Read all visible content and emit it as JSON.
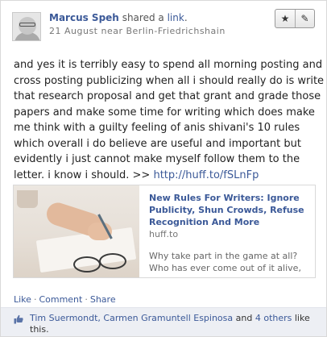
{
  "post": {
    "author": "Marcus Speh",
    "shared_text": "shared a",
    "shared_object": "link",
    "shared_dot": ".",
    "date_location": "21 August near Berlin-Friedrichshain",
    "actions_icons": [
      "star-icon",
      "pencil-icon"
    ],
    "text_lines": [
      "and yes it is terribly easy to spend all morning posting and",
      "cross posting publicizing when all i should really do is write",
      "that research proposal and get that grant and grade those",
      "papers and make some time for writing which does make",
      "me think with a guilty feeling of anis shivani's 10 rules",
      "which overall i do believe are useful and important but",
      "evidently i just cannot make myself follow them to the",
      "letter. i know i should. >> "
    ],
    "text_link": "http://huff.to/fSLnFp"
  },
  "preview": {
    "title_lines": [
      "New Rules For Writers: Ignore",
      "Publicity, Shun Crowds, Refuse",
      "Recognition And More"
    ],
    "domain": "huff.to",
    "description_lines": [
      "Why take part in the game at all?",
      "Who has ever come out of it alive,"
    ]
  },
  "footer": {
    "like": "Like",
    "comment": "Comment",
    "share": "Share",
    "sep": "·",
    "likers": "Tim Suermondt, Carmen Gramuntell Espinosa",
    "and_text": " and ",
    "others": "4 others",
    "like_this_1": " like",
    "like_this_2": "this."
  },
  "colors": {
    "link": "#3b5998",
    "likes_bar": "#edeff4"
  }
}
